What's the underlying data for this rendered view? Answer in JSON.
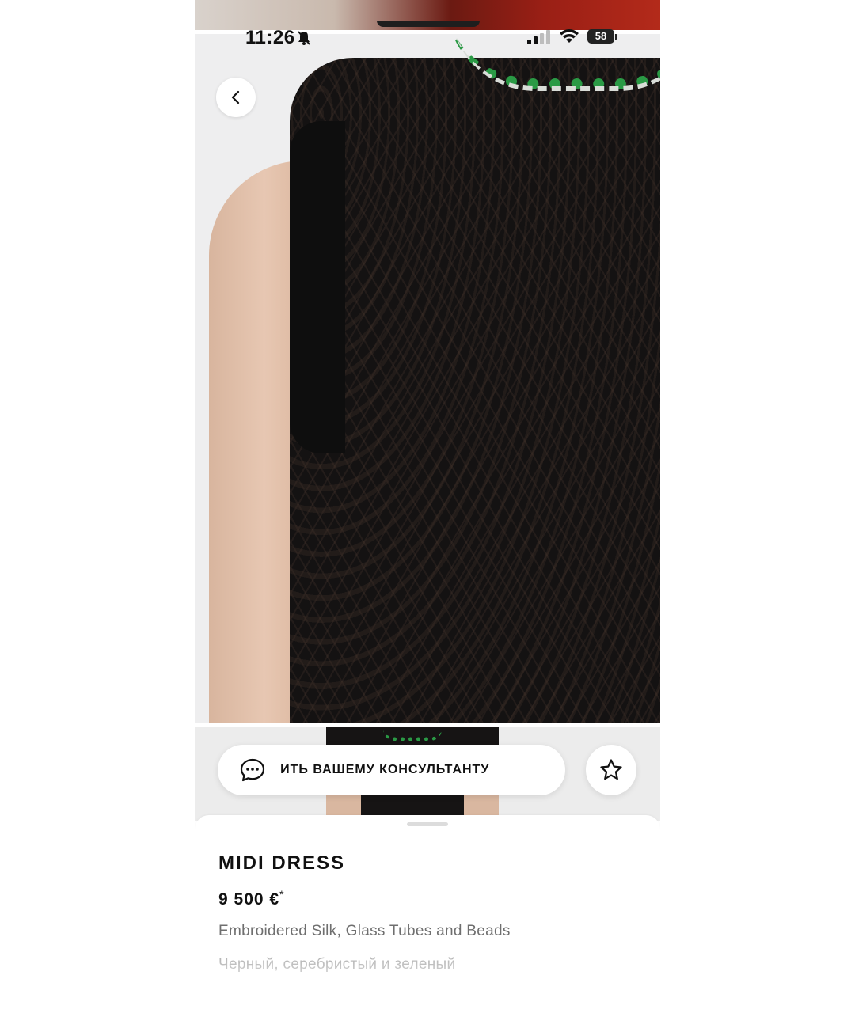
{
  "status_bar": {
    "time": "11:26",
    "battery": "58"
  },
  "nav": {
    "back_icon": "chevron-left-icon"
  },
  "actions": {
    "consult_label": "АВИТЬ ВАШЕМУ КОНСУЛЬТАНТУ",
    "consult_icon": "chat-bubble-icon",
    "favorite_icon": "star-outline-icon"
  },
  "product": {
    "name": "MIDI DRESS",
    "price": "9 500 €",
    "price_note": "*",
    "material": "Embroidered Silk, Glass Tubes and Beads",
    "color": "Черный, серебристый и зеленый"
  },
  "colors": {
    "background": "#ffffff",
    "text": "#111111",
    "muted_text": "#6f6f6f",
    "embroidery_green": "#2a9a45"
  }
}
